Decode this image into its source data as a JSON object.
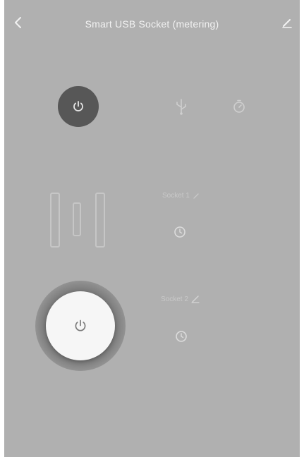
{
  "header": {
    "title": "Smart USB Socket (metering)",
    "back_icon": "chevron-left-icon",
    "edit_icon": "pencil-icon"
  },
  "controls": {
    "main_power_icon": "power-icon",
    "usb_icon": "usb-icon",
    "timer_icon": "timer-icon"
  },
  "sockets": [
    {
      "label": "Socket 1",
      "edit_icon": "pencil-icon",
      "timer_icon": "clock-icon"
    },
    {
      "label": "Socket 2",
      "edit_icon": "pencil-icon",
      "timer_icon": "clock-icon"
    }
  ],
  "big_power": {
    "icon": "power-icon",
    "state": "on"
  },
  "colors": {
    "background": "#b0b0b0",
    "main_power_bg": "#575757",
    "header_text": "#f2f2f2",
    "big_power_bg": "#f6f6f6"
  }
}
